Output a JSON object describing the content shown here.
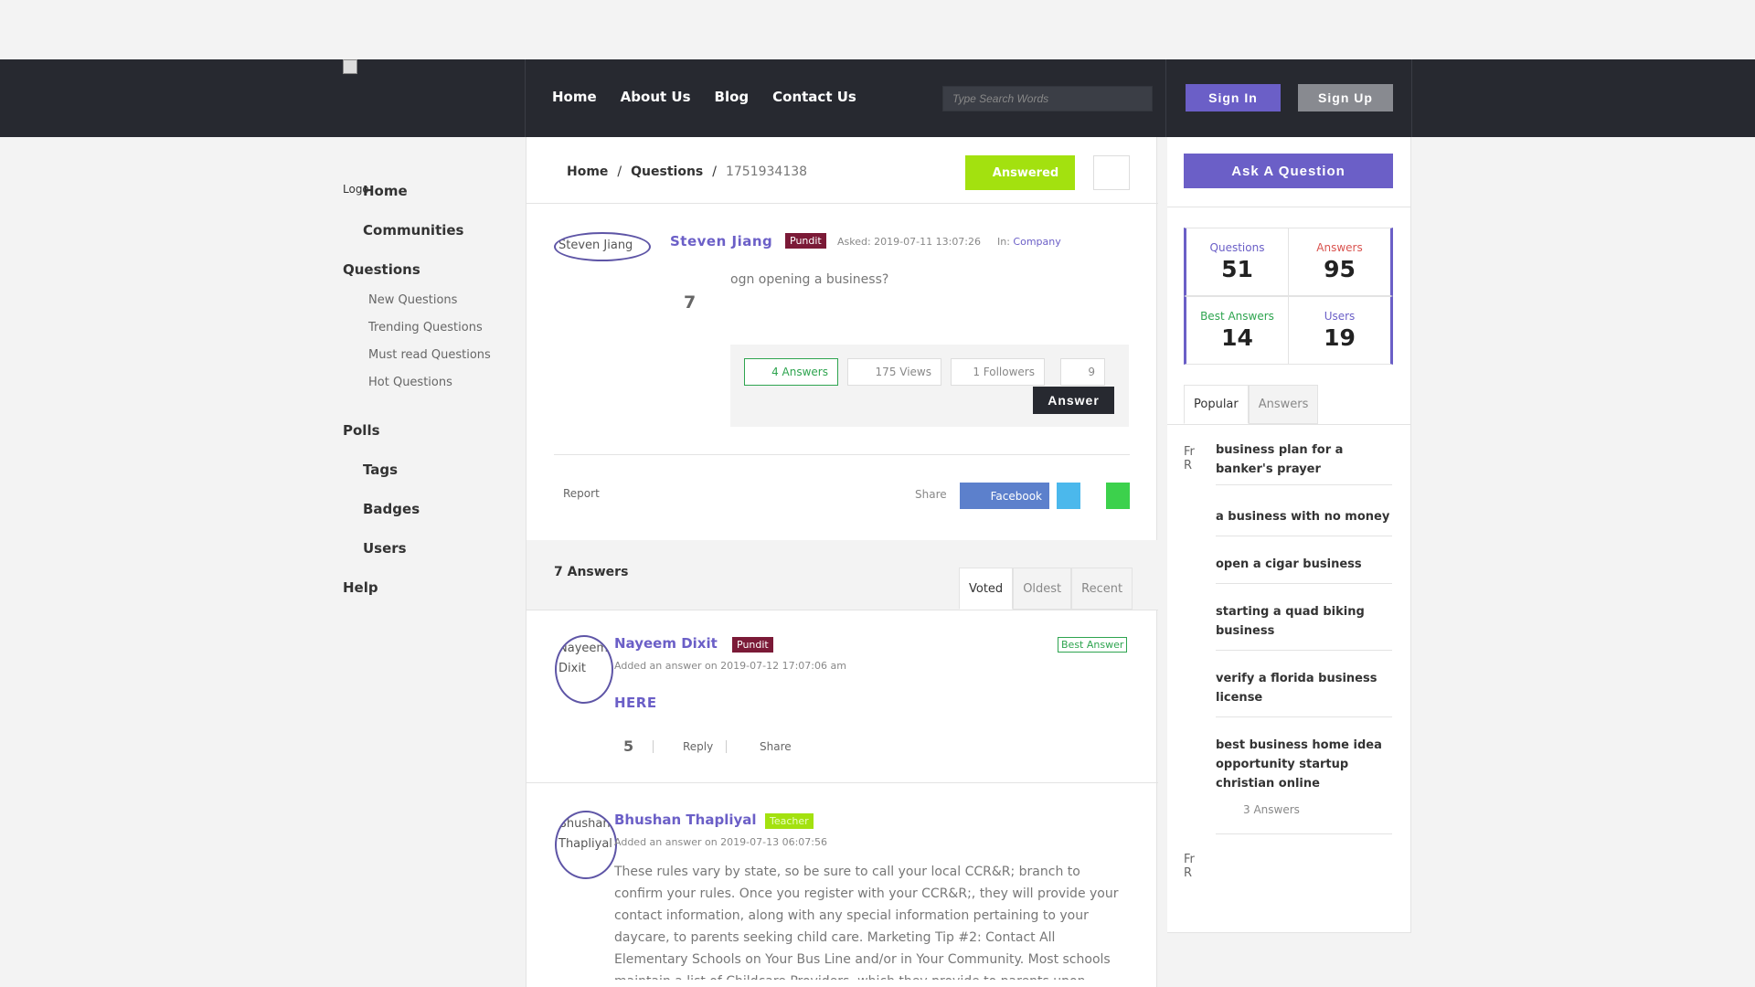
{
  "header": {
    "nav": [
      "Home",
      "About Us",
      "Blog",
      "Contact Us"
    ],
    "search_placeholder": "Type Search Words",
    "signin": "Sign In",
    "signup": "Sign Up"
  },
  "sidebar": {
    "logo_alt": "Logo",
    "items": [
      {
        "label": "Home"
      },
      {
        "label": "Communities"
      },
      {
        "label": "Questions"
      },
      {
        "label": "New Questions"
      },
      {
        "label": "Trending Questions"
      },
      {
        "label": "Must read Questions"
      },
      {
        "label": "Hot Questions"
      },
      {
        "label": "Polls"
      },
      {
        "label": "Tags"
      },
      {
        "label": "Badges"
      },
      {
        "label": "Users"
      },
      {
        "label": "Help"
      }
    ]
  },
  "breadcrumb": {
    "home": "Home",
    "questions": "Questions",
    "current": "1751934138",
    "sep": "/"
  },
  "status": {
    "answered": "Answered"
  },
  "question": {
    "avatar_alt": "Steven Jiang",
    "author": "Steven Jiang",
    "badge": "Pundit",
    "asked": "Asked: 2019-07-11 13:07:26",
    "in_label": "In:",
    "category": "Company",
    "title": "ogn opening a business?",
    "votes": "7",
    "answers_chip": "4 Answers",
    "views_chip": "175 Views",
    "followers_chip": "1 Followers",
    "extra_chip": "9",
    "answer_btn": "Answer",
    "report": "Report",
    "share": "Share",
    "facebook": "Facebook"
  },
  "answers": {
    "count": "7 Answers",
    "tabs": [
      "Voted",
      "Oldest",
      "Recent"
    ],
    "list": [
      {
        "avatar_alt": "Nayeem Dixit",
        "author": "Nayeem Dixit",
        "badge": "Pundit",
        "date": "Added an answer on 2019-07-12 17:07:06 am",
        "best": "Best Answer",
        "body": "HERE",
        "votes": "5",
        "reply": "Reply",
        "share": "Share"
      },
      {
        "avatar_alt": "Bhushan Thapliyal",
        "author": "Bhushan Thapliyal",
        "badge": "Teacher",
        "date": "Added an answer on 2019-07-13 06:07:56",
        "body": "These rules vary by state, so be sure to call your local CCR&R; branch to confirm your rules. Once you register with your CCR&R;, they will provide your contact information, along with any special information pertaining to your daycare, to parents seeking child care. Marketing Tip #2: Contact All Elementary Schools on Your Bus Line and/or in Your Community. Most schools maintain a list of Childcare Providers, which they provide to parents upon"
      }
    ]
  },
  "right": {
    "ask": "Ask A Question",
    "stats": [
      {
        "label": "Questions",
        "value": "51",
        "color": "#6b5fc7"
      },
      {
        "label": "Answers",
        "value": "95",
        "color": "#d9534f"
      },
      {
        "label": "Best Answers",
        "value": "14",
        "color": "#2ea44f"
      },
      {
        "label": "Users",
        "value": "19",
        "color": "#6b5fc7"
      }
    ],
    "tabs": [
      "Popular",
      "Answers"
    ],
    "thumb_alt": "Fr R",
    "popular": [
      "business plan for a banker's prayer",
      "a business with no money",
      "open a cigar business",
      "starting a quad biking business",
      "verify a florida business license",
      "best business home idea opportunity startup christian online"
    ],
    "popular_sub": "3 Answers"
  },
  "colors": {
    "accent": "#6b5fc7",
    "header": "#272930",
    "answered": "#a3e10f",
    "pundit": "#7b1a37"
  }
}
